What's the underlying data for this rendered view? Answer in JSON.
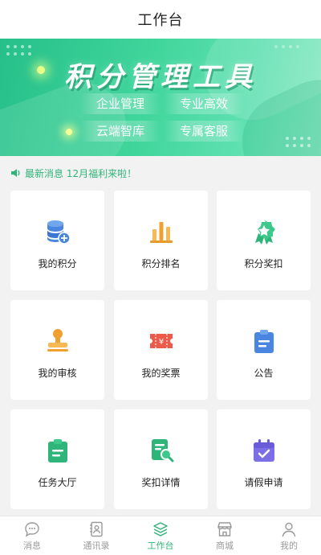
{
  "header": {
    "title": "工作台"
  },
  "banner": {
    "title": "积分管理工具",
    "tags": [
      "企业管理",
      "专业高效",
      "云端智库",
      "专属客服"
    ]
  },
  "notice": {
    "text": "最新消息 12月福利来啦！"
  },
  "grid": {
    "items": [
      {
        "label": "我的积分",
        "icon": "database-coin-icon"
      },
      {
        "label": "积分排名",
        "icon": "bar-chart-icon"
      },
      {
        "label": "积分奖扣",
        "icon": "award-badge-icon"
      },
      {
        "label": "我的审核",
        "icon": "stamp-icon"
      },
      {
        "label": "我的奖票",
        "icon": "ticket-icon"
      },
      {
        "label": "公告",
        "icon": "clipboard-icon"
      },
      {
        "label": "任务大厅",
        "icon": "task-clipboard-icon"
      },
      {
        "label": "奖扣详情",
        "icon": "document-search-icon"
      },
      {
        "label": "请假申请",
        "icon": "calendar-check-icon"
      }
    ]
  },
  "tabbar": {
    "tabs": [
      {
        "label": "消息",
        "icon": "chat-bubble-icon",
        "active": false
      },
      {
        "label": "通讯录",
        "icon": "contacts-icon",
        "active": false
      },
      {
        "label": "工作台",
        "icon": "layers-icon",
        "active": true
      },
      {
        "label": "商城",
        "icon": "store-icon",
        "active": false
      },
      {
        "label": "我的",
        "icon": "user-icon",
        "active": false
      }
    ]
  },
  "colors": {
    "accent": "#2fb47a",
    "banner": "#3fd59b",
    "background": "#f2f2f2"
  }
}
